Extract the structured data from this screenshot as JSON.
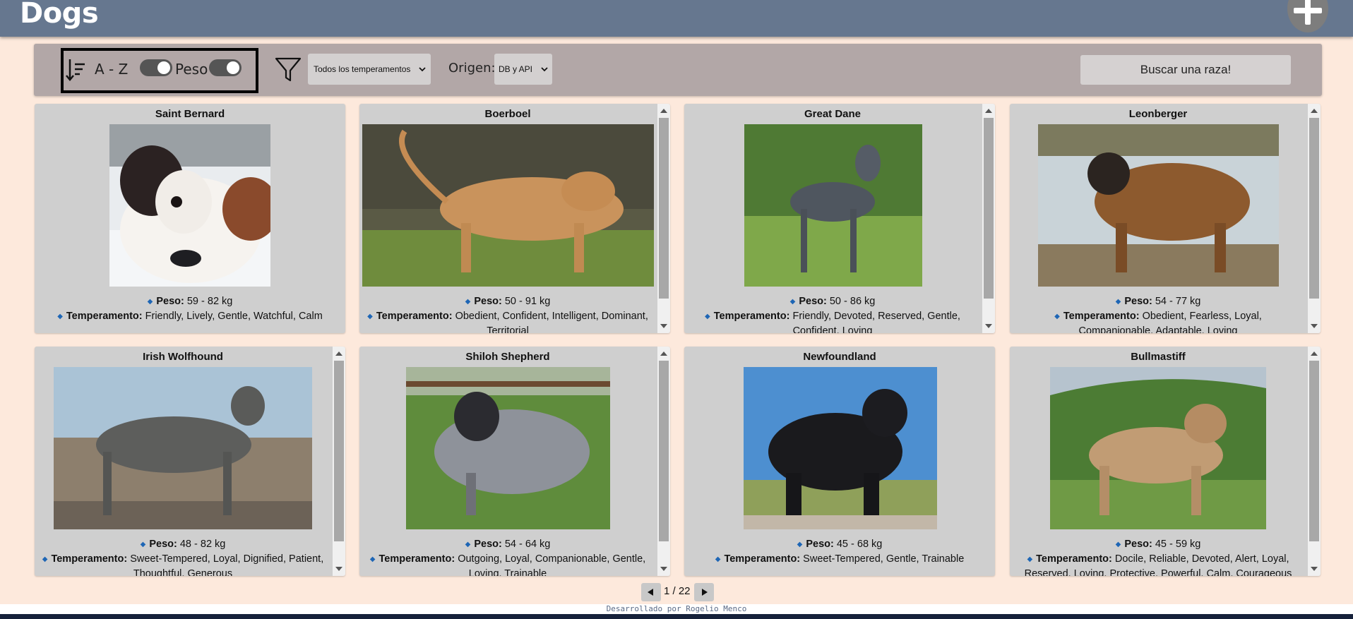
{
  "header": {
    "title": "Dogs",
    "add_icon": "plus-icon"
  },
  "toolbar": {
    "sort_icon": "sort-descending-icon",
    "sort_az_label": "A - Z",
    "sort_weight_label": "Peso",
    "filter_icon": "filter-funnel-icon",
    "temperament_select": "Todos los temperamentos",
    "origin_label": "Origen:",
    "origin_select": "DB y API",
    "search_placeholder": "Buscar una raza!"
  },
  "labels": {
    "weight": "Peso:",
    "temperament": "Temperamento:"
  },
  "breeds": [
    {
      "name": "Saint Bernard",
      "weight": "59 - 82 kg",
      "temperament": "Friendly, Lively, Gentle, Watchful, Calm"
    },
    {
      "name": "Boerboel",
      "weight": "50 - 91 kg",
      "temperament": "Obedient, Confident, Intelligent, Dominant, Territorial"
    },
    {
      "name": "Great Dane",
      "weight": "50 - 86 kg",
      "temperament": "Friendly, Devoted, Reserved, Gentle, Confident, Loving"
    },
    {
      "name": "Leonberger",
      "weight": "54 - 77 kg",
      "temperament": "Obedient, Fearless, Loyal, Companionable, Adaptable, Loving"
    },
    {
      "name": "Irish Wolfhound",
      "weight": "48 - 82 kg",
      "temperament": "Sweet-Tempered, Loyal, Dignified, Patient, Thoughtful, Generous"
    },
    {
      "name": "Shiloh Shepherd",
      "weight": "54 - 64 kg",
      "temperament": "Outgoing, Loyal, Companionable, Gentle, Loving, Trainable"
    },
    {
      "name": "Newfoundland",
      "weight": "45 - 68 kg",
      "temperament": "Sweet-Tempered, Gentle, Trainable"
    },
    {
      "name": "Bullmastiff",
      "weight": "45 - 59 kg",
      "temperament": "Docile, Reliable, Devoted, Alert, Loyal, Reserved, Loving, Protective, Powerful, Calm, Courageous"
    }
  ],
  "pagination": {
    "label": "1 / 22",
    "prev_icon": "triangle-left-icon",
    "next_icon": "triangle-right-icon"
  },
  "footer": {
    "text": "Desarrollado por Rogelio Menco"
  },
  "colors": {
    "header": "#66778f",
    "page_bg": "#fde9dc",
    "toolbar": "#b2a7a7",
    "card": "#cfcfcf",
    "bullet": "#1e66b5"
  }
}
